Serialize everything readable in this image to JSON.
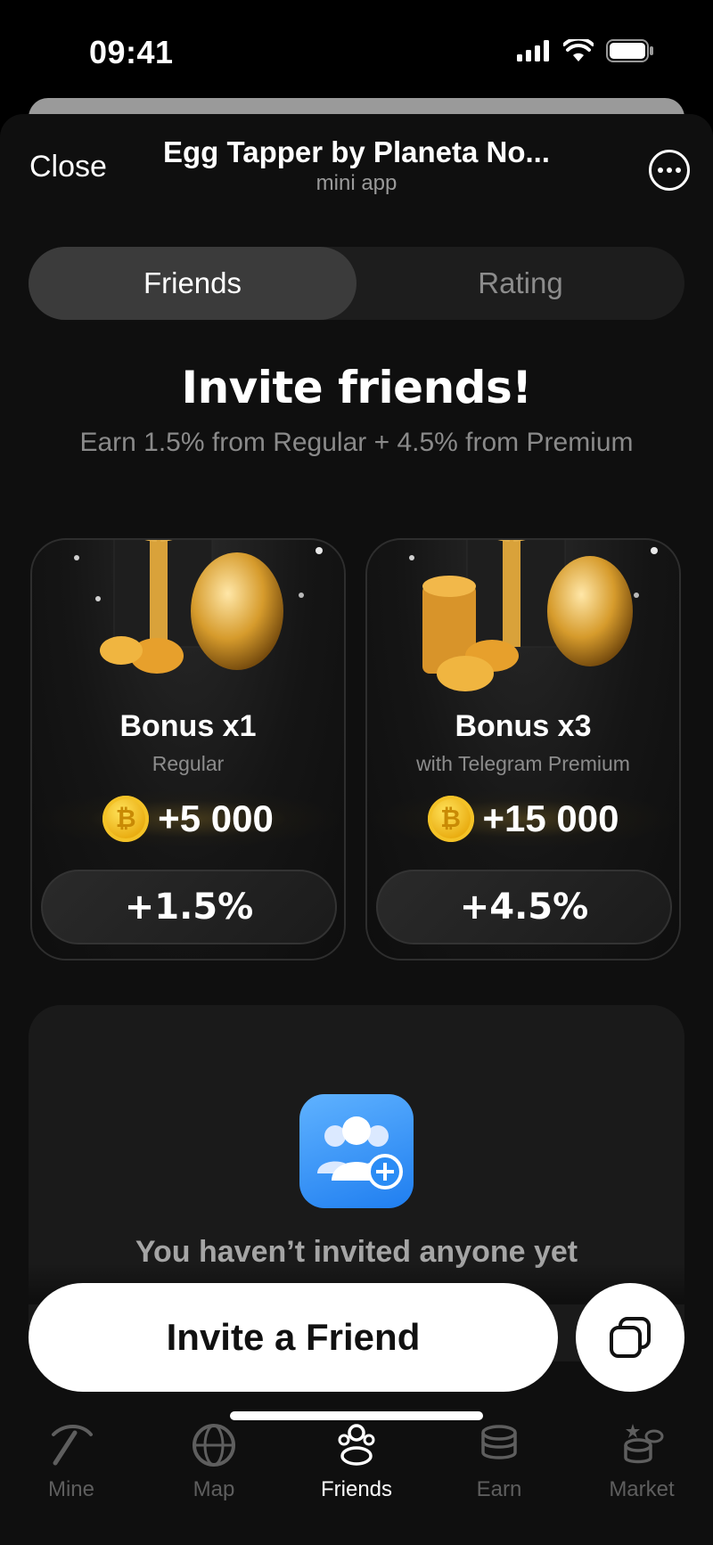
{
  "status_bar": {
    "time": "09:41"
  },
  "header": {
    "close_label": "Close",
    "title": "Egg Tapper by Planeta No...",
    "subtitle": "mini app"
  },
  "tabs": [
    {
      "label": "Friends",
      "active": true
    },
    {
      "label": "Rating",
      "active": false
    }
  ],
  "invite": {
    "title": "Invite friends!",
    "subtitle": "Earn 1.5% from Regular + 4.5% from Premium"
  },
  "bonus_cards": [
    {
      "title": "Bonus x1",
      "subtitle": "Regular",
      "reward": "+5 000",
      "percent": "+1.5%"
    },
    {
      "title": "Bonus x3",
      "subtitle": "with Telegram Premium",
      "reward": "+15 000",
      "percent": "+4.5%"
    }
  ],
  "empty_state": {
    "text": "You haven’t invited anyone yet"
  },
  "actions": {
    "invite_label": "Invite a Friend"
  },
  "bottom_nav": [
    {
      "label": "Mine",
      "icon": "pickaxe-icon",
      "active": false
    },
    {
      "label": "Map",
      "icon": "globe-icon",
      "active": false
    },
    {
      "label": "Friends",
      "icon": "friends-icon",
      "active": true
    },
    {
      "label": "Earn",
      "icon": "coins-icon",
      "active": false
    },
    {
      "label": "Market",
      "icon": "market-icon",
      "active": false
    }
  ],
  "colors": {
    "background": "#0f0f0f",
    "gold": "#e8a90c",
    "accent_blue": "#1f7ef0"
  }
}
